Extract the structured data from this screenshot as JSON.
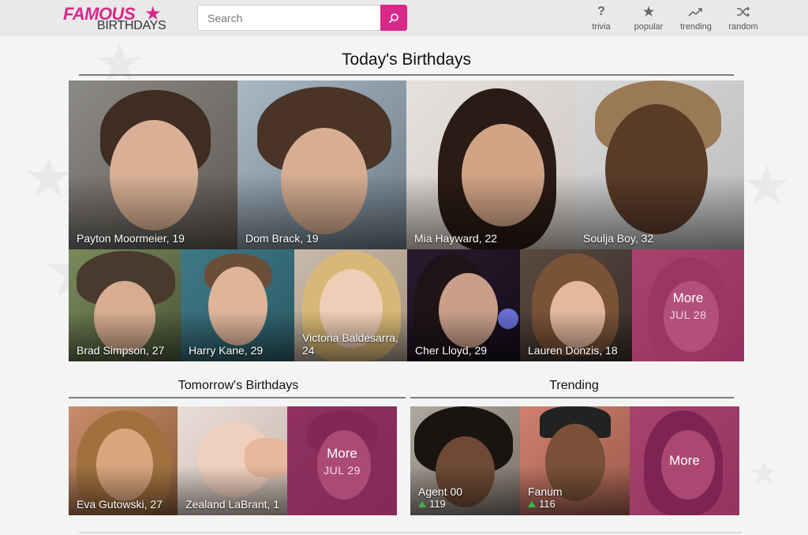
{
  "logo": {
    "famous": "FAMOUS",
    "birthdays": "BIRTHDAYS"
  },
  "search": {
    "placeholder": "Search"
  },
  "nav": [
    {
      "label": "trivia",
      "icon": "question-icon"
    },
    {
      "label": "popular",
      "icon": "star-icon"
    },
    {
      "label": "trending",
      "icon": "trending-icon"
    },
    {
      "label": "random",
      "icon": "shuffle-icon"
    }
  ],
  "today": {
    "title": "Today's Birthdays",
    "people": [
      {
        "caption": "Payton Moormeier, 19"
      },
      {
        "caption": "Dom Brack, 19"
      },
      {
        "caption": "Mia Hayward, 22"
      },
      {
        "caption": "Soulja Boy, 32"
      },
      {
        "caption": "Brad Simpson, 27"
      },
      {
        "caption": "Harry Kane, 29"
      },
      {
        "caption": "Victoria Baldesarra, 24"
      },
      {
        "caption": "Cher Lloyd, 29"
      },
      {
        "caption": "Lauren Donzis, 18"
      }
    ],
    "more": {
      "label": "More",
      "date": "JUL 28"
    }
  },
  "tomorrow": {
    "title": "Tomorrow's Birthdays",
    "people": [
      {
        "caption": "Eva Gutowski, 27"
      },
      {
        "caption": "Zealand LaBrant, 1"
      }
    ],
    "more": {
      "label": "More",
      "date": "JUL 29"
    }
  },
  "trending": {
    "title": "Trending",
    "people": [
      {
        "name": "Agent 00",
        "rank": "119"
      },
      {
        "name": "Fanum",
        "rank": "116"
      }
    ],
    "more": {
      "label": "More"
    }
  },
  "colors": {
    "brand": "#d9288a",
    "overlay": "#a0286e",
    "trend_up": "#39b54a"
  }
}
